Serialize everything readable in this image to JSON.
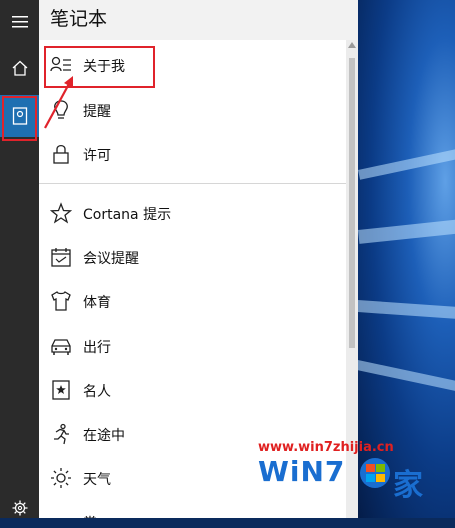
{
  "panel": {
    "title": "笔记本"
  },
  "items": [
    {
      "label": "关于我",
      "icon": "about-me-icon"
    },
    {
      "label": "提醒",
      "icon": "reminder-lightbulb-icon"
    },
    {
      "label": "许可",
      "icon": "lock-icon"
    },
    {
      "label": "Cortana 提示",
      "icon": "star-icon"
    },
    {
      "label": "会议提醒",
      "icon": "calendar-icon"
    },
    {
      "label": "体育",
      "icon": "jersey-icon"
    },
    {
      "label": "出行",
      "icon": "car-icon"
    },
    {
      "label": "名人",
      "icon": "celebrity-star-icon"
    },
    {
      "label": "在途中",
      "icon": "running-person-icon"
    },
    {
      "label": "天气",
      "icon": "sun-icon"
    },
    {
      "label": "赏",
      "icon": "partial-icon"
    }
  ],
  "rail": [
    "hamburger-menu-icon",
    "home-icon",
    "notebook-icon",
    "settings-gear-icon"
  ],
  "watermark": {
    "url": "www.win7zhijia.cn",
    "logo": "WiN7",
    "logo_suffix": "家"
  },
  "colors": {
    "accent": "#1e6fb1",
    "annotation_red": "#e0232b",
    "watermark_blue": "#1a6ed0"
  }
}
